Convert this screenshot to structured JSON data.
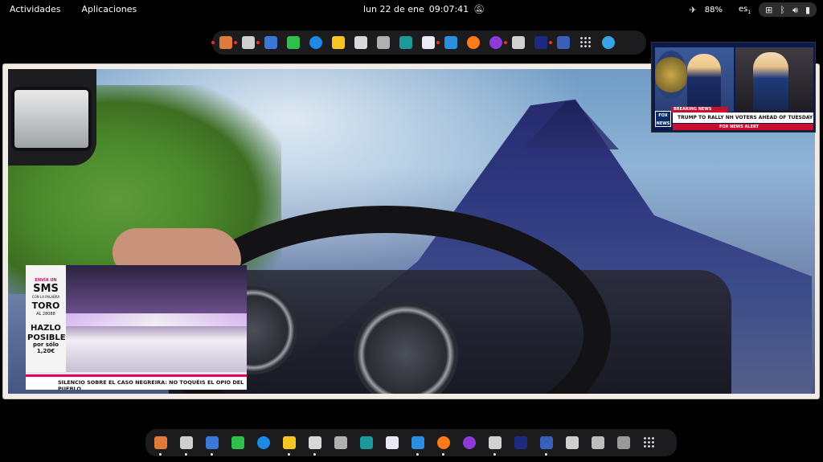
{
  "topbar": {
    "activities": "Actividades",
    "applications": "Aplicaciones",
    "date": "lun 22 de ene",
    "time": "09:07:41",
    "battery": "88%",
    "keyboard_layout": "es",
    "keyboard_layout_sub": "1"
  },
  "top_dock": {
    "apps": [
      {
        "icon": "toolbox-icon",
        "color": "#e07a3a",
        "running": true
      },
      {
        "icon": "printer-icon",
        "color": "#cfcfcf",
        "running": true
      },
      {
        "icon": "screenshot-icon",
        "color": "#3a78d8",
        "running": true
      },
      {
        "icon": "puzzle-icon",
        "color": "#2ec04a",
        "running": false
      },
      {
        "icon": "edge-browser-icon",
        "color": "#1e88e5",
        "running": false
      },
      {
        "icon": "notes-icon",
        "color": "#f3c623",
        "running": false
      },
      {
        "icon": "keyboard-icon",
        "color": "#d8d8d8",
        "running": false
      },
      {
        "icon": "package-icon",
        "color": "#b0b0b0",
        "running": false
      },
      {
        "icon": "terminal-icon",
        "color": "#1a9a9a",
        "running": false
      },
      {
        "icon": "store-bag-icon",
        "color": "#e9e9f5",
        "running": false
      },
      {
        "icon": "briefcase-icon",
        "color": "#2b8fe0",
        "running": true
      },
      {
        "icon": "firefox-icon",
        "color": "#ff7b1a",
        "running": false
      },
      {
        "icon": "podcast-icon",
        "color": "#8e3ad8",
        "running": false
      },
      {
        "icon": "display-settings-icon",
        "color": "#d0d0d0",
        "running": true
      },
      {
        "icon": "inkscape-icon",
        "color": "#1d2a80",
        "running": false
      },
      {
        "icon": "flag-icon",
        "color": "#3a5fb8",
        "running": true
      },
      {
        "icon": "app-grid-icon",
        "color": "#e0e0e0",
        "running": false
      },
      {
        "icon": "more-icon",
        "color": "#39a5e8",
        "running": false
      }
    ]
  },
  "bottom_dock": {
    "apps": [
      {
        "icon": "toolbox-icon",
        "color": "#e07a3a",
        "running": true
      },
      {
        "icon": "printer-icon",
        "color": "#cfcfcf",
        "running": true
      },
      {
        "icon": "screenshot-icon",
        "color": "#3a78d8",
        "running": true
      },
      {
        "icon": "puzzle-icon",
        "color": "#2ec04a",
        "running": false
      },
      {
        "icon": "edge-browser-icon",
        "color": "#1e88e5",
        "running": false
      },
      {
        "icon": "notes-icon",
        "color": "#f3c623",
        "running": true
      },
      {
        "icon": "keyboard-icon",
        "color": "#d8d8d8",
        "running": true
      },
      {
        "icon": "package-icon",
        "color": "#b0b0b0",
        "running": false
      },
      {
        "icon": "terminal-icon",
        "color": "#1a9a9a",
        "running": false
      },
      {
        "icon": "store-bag-icon",
        "color": "#e9e9f5",
        "running": false
      },
      {
        "icon": "briefcase-icon",
        "color": "#2b8fe0",
        "running": true
      },
      {
        "icon": "firefox-icon",
        "color": "#ff7b1a",
        "running": true
      },
      {
        "icon": "podcast-icon",
        "color": "#8e3ad8",
        "running": false
      },
      {
        "icon": "display-settings-icon",
        "color": "#d0d0d0",
        "running": true
      },
      {
        "icon": "inkscape-icon",
        "color": "#1d2a80",
        "running": false
      },
      {
        "icon": "flag-icon",
        "color": "#3a5fb8",
        "running": true
      },
      {
        "icon": "drive-icon",
        "color": "#cfcfcf",
        "running": false
      },
      {
        "icon": "drive-alt-icon",
        "color": "#bdbdbd",
        "running": false
      },
      {
        "icon": "trash-icon",
        "color": "#9a9a9a",
        "running": false
      },
      {
        "icon": "app-grid-icon",
        "color": "#e0e0e0",
        "running": false
      }
    ]
  },
  "tv_left": {
    "promo_line1": "ENVÍA UN",
    "promo_sms": "SMS",
    "promo_line3": "CON LA PALABRA",
    "promo_word": "TORO",
    "promo_number": "AL 28088",
    "promo_hazlo": "HAZLO",
    "promo_posible": "POSIBLE",
    "promo_price": "por sólo 1,20€",
    "ticker": "SILENCIO SOBRE EL CASO NEGREIRA: NO TOQUÉIS EL OPIO DEL PUEBLO"
  },
  "tv_right": {
    "breaking": "BREAKING NEWS",
    "logo": "FOX NEWS",
    "headline": "TRUMP TO RALLY NH VOTERS AHEAD OF TUESDAY PRIMARY",
    "alert": "FOX NEWS ALERT"
  }
}
